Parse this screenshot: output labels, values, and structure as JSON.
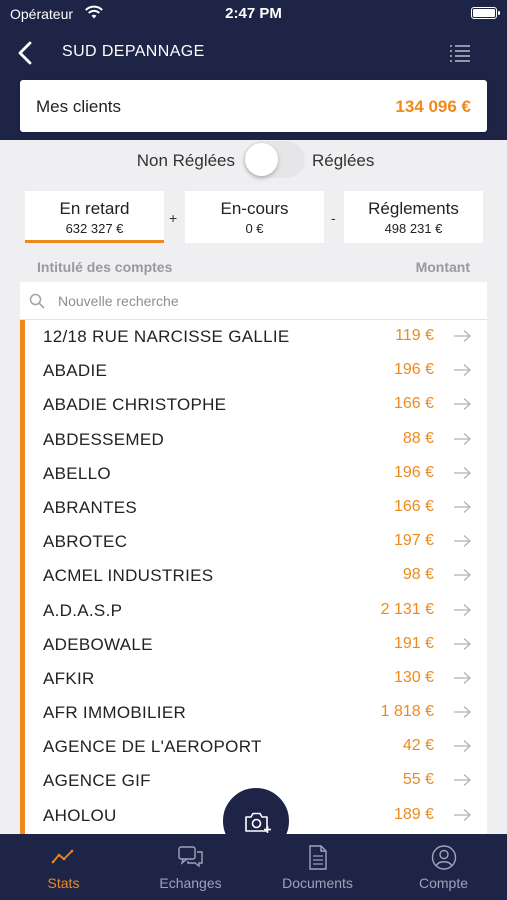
{
  "status_bar": {
    "carrier": "Opérateur",
    "time": "2:47 PM"
  },
  "nav": {
    "title": "SUD DEPANNAGE"
  },
  "clients_card": {
    "label": "Mes clients",
    "amount": "134 096 €"
  },
  "filter_toggle": {
    "left_label": "Non Réglées",
    "right_label": "Réglées",
    "checked": false
  },
  "summary": {
    "late": {
      "title": "En retard",
      "value": "632 327 €"
    },
    "plus": "+",
    "current": {
      "title": "En-cours",
      "value": "0 €"
    },
    "minus": "-",
    "payments": {
      "title": "Réglements",
      "value": "498 231 €"
    }
  },
  "list_header": {
    "accounts": "Intitulé des comptes",
    "amount": "Montant"
  },
  "search": {
    "placeholder": "Nouvelle recherche"
  },
  "accounts": [
    {
      "name": "12/18 RUE NARCISSE GALLIE",
      "amount": "119 €"
    },
    {
      "name": "ABADIE",
      "amount": "196 €"
    },
    {
      "name": "ABADIE CHRISTOPHE",
      "amount": "166 €"
    },
    {
      "name": "ABDESSEMED",
      "amount": "88 €"
    },
    {
      "name": "ABELLO",
      "amount": "196 €"
    },
    {
      "name": "ABRANTES",
      "amount": "166 €"
    },
    {
      "name": "ABROTEC",
      "amount": "197 €"
    },
    {
      "name": "ACMEL INDUSTRIES",
      "amount": "98 €"
    },
    {
      "name": "A.D.A.S.P",
      "amount": "2 131 €"
    },
    {
      "name": "ADEBOWALE",
      "amount": "191 €"
    },
    {
      "name": "AFKIR",
      "amount": "130 €"
    },
    {
      "name": "AFR IMMOBILIER",
      "amount": "1 818 €"
    },
    {
      "name": "AGENCE DE L'AEROPORT",
      "amount": "42 €"
    },
    {
      "name": "AGENCE GIF",
      "amount": "55 €"
    },
    {
      "name": "AHOLOU",
      "amount": "189 €"
    },
    {
      "name": "",
      "amount": ""
    }
  ],
  "tabs": [
    {
      "label": "Stats",
      "icon": "stats-chart-icon",
      "active": true
    },
    {
      "label": "Echanges",
      "icon": "chat-bubbles-icon",
      "active": false
    },
    {
      "label": "Documents",
      "icon": "document-icon",
      "active": false
    },
    {
      "label": "Compte",
      "icon": "user-circle-icon",
      "active": false
    }
  ],
  "fab": {
    "icon": "camera-add-icon"
  },
  "colors": {
    "navy": "#1e2446",
    "accent": "#ee8a1d",
    "background": "#efeff1"
  }
}
